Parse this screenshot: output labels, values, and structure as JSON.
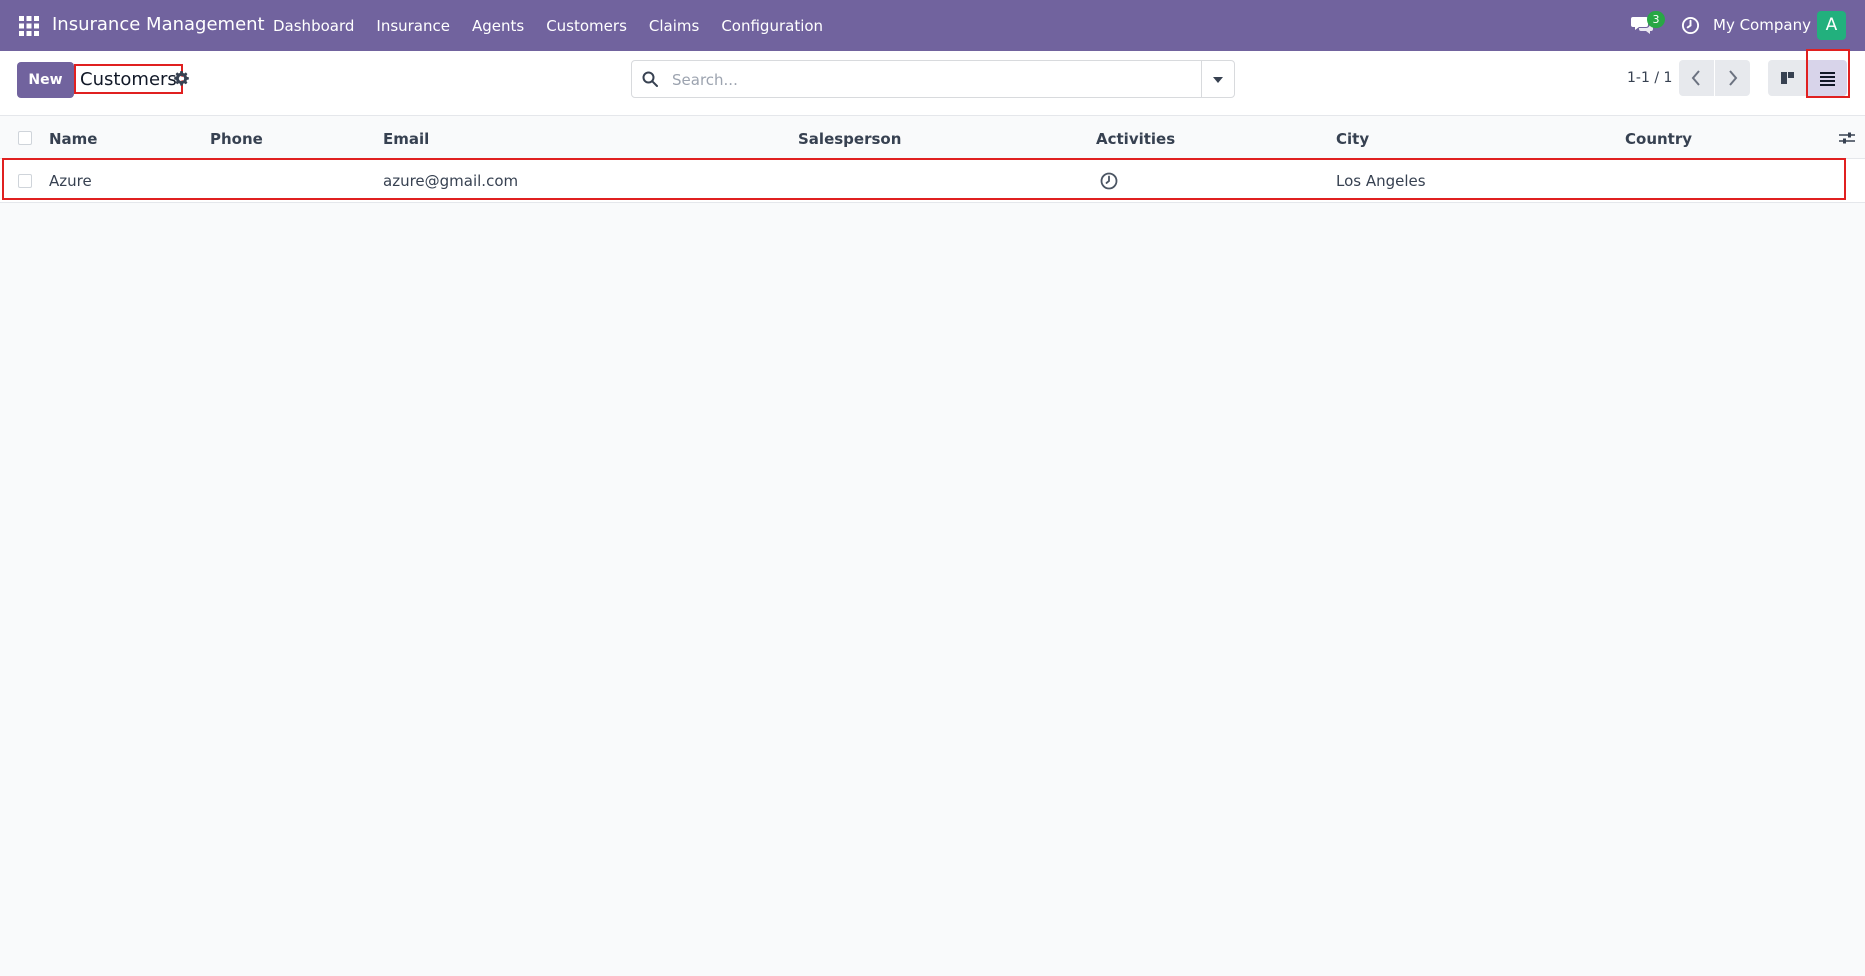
{
  "navbar": {
    "app_title": "Insurance Management",
    "menu": [
      "Dashboard",
      "Insurance",
      "Agents",
      "Customers",
      "Claims",
      "Configuration"
    ],
    "chat_badge": "3",
    "company": "My Company",
    "avatar_initial": "A",
    "bg_color": "#71639e"
  },
  "control_panel": {
    "new_label": "New",
    "title": "Customers",
    "search_placeholder": "Search...",
    "pager": "1-1 / 1"
  },
  "table": {
    "columns": [
      "Name",
      "Phone",
      "Email",
      "Salesperson",
      "Activities",
      "City",
      "Country"
    ],
    "rows": [
      {
        "name": "Azure",
        "phone": "",
        "email": "azure@gmail.com",
        "salesperson": "",
        "activities": "clock-icon",
        "city": "Los Angeles",
        "country": ""
      }
    ]
  },
  "icons": {
    "apps": "grid-icon",
    "chat": "chat-icon",
    "activity": "clock-icon",
    "settings": "gear-icon",
    "search": "search-icon",
    "kanban_view": "kanban-icon",
    "list_view": "list-icon"
  }
}
